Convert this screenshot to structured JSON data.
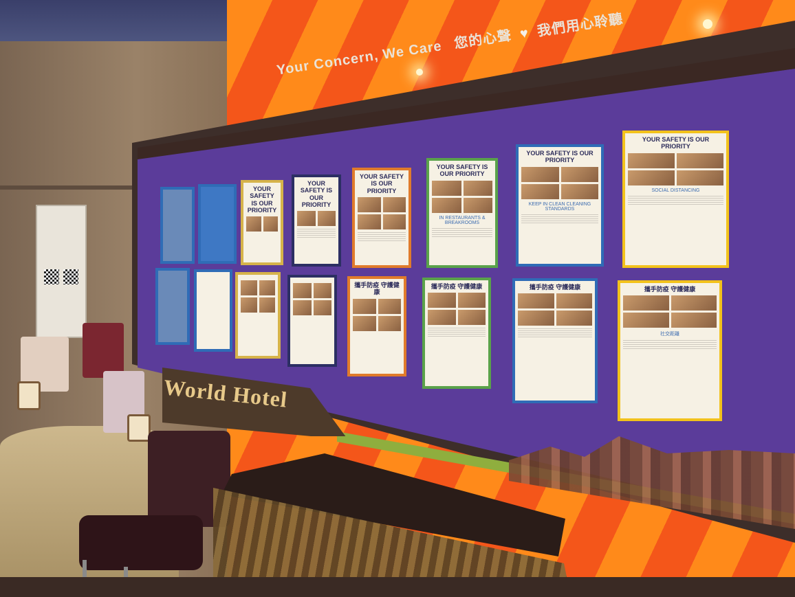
{
  "header": {
    "slogan_en": "Your Concern, We Care",
    "slogan_zh_1": "您的心聲",
    "slogan_zh_2": "我們用心聆聽"
  },
  "sign": {
    "text": "World Hotel"
  },
  "posters_top": [
    {
      "title": "YOUR SAFETY IS OUR PRIORITY",
      "caption": "SOCIAL DISTANCING"
    },
    {
      "title": "YOUR SAFETY IS OUR PRIORITY",
      "caption": "KEEP IN CLEAN CLEANING STANDARDS"
    },
    {
      "title": "YOUR SAFETY IS OUR PRIORITY",
      "caption": "IN RESTAURANTS & BREAKROOMS"
    },
    {
      "title": "YOUR SAFETY IS OUR PRIORITY",
      "caption": ""
    },
    {
      "title": "YOUR SAFETY IS OUR PRIORITY",
      "caption": ""
    },
    {
      "title": "YOUR SAFETY IS OUR PRIORITY",
      "caption": ""
    }
  ],
  "posters_bottom": [
    {
      "title": "攜手防疫 守護健康",
      "caption": "社交距離"
    },
    {
      "title": "攜手防疫 守護健康",
      "caption": ""
    },
    {
      "title": "攜手防疫 守護健康",
      "caption": ""
    },
    {
      "title": "攜手防疫 守護健康",
      "caption": ""
    }
  ],
  "colors": {
    "board": "#5b3c9a",
    "wall_orange": "#ff8a1a",
    "poster_yellow": "#f2c21c",
    "poster_blue": "#2f6cb6",
    "poster_green": "#5aa24a",
    "poster_orange": "#e07b2b"
  },
  "icons": [
    "heart-icon",
    "checkmark-icon",
    "qr-code-icon"
  ]
}
